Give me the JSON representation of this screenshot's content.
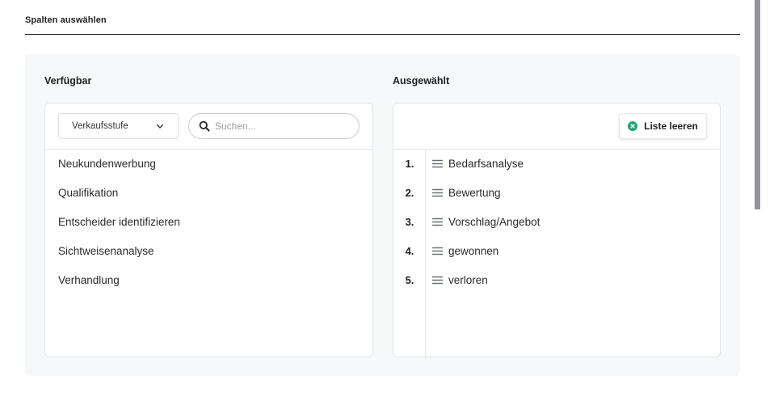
{
  "section": {
    "title": "Spalten auswählen"
  },
  "available": {
    "title": "Verfügbar",
    "filter_select": {
      "selected": "Verkaufsstufe"
    },
    "search": {
      "placeholder": "Suchen...",
      "value": ""
    },
    "items": [
      {
        "label": "Neukundenwerbung"
      },
      {
        "label": "Qualifikation"
      },
      {
        "label": "Entscheider identifizieren"
      },
      {
        "label": "Sichtweisenanalyse"
      },
      {
        "label": "Verhandlung"
      }
    ]
  },
  "selected": {
    "title": "Ausgewählt",
    "clear_button": "Liste leeren",
    "items": [
      {
        "num": "1.",
        "label": "Bedarfsanalyse"
      },
      {
        "num": "2.",
        "label": "Bewertung"
      },
      {
        "num": "3.",
        "label": "Vorschlag/Angebot"
      },
      {
        "num": "4.",
        "label": "gewonnen"
      },
      {
        "num": "5.",
        "label": "verloren"
      }
    ]
  },
  "icons": {
    "select": "chevron-down-icon",
    "search": "search-icon",
    "clear": "close-circle-icon",
    "drag": "drag-handle-icon"
  },
  "colors": {
    "accent_green": "#17a673",
    "panel_bg": "#f7f8f9",
    "border": "#e3e5e8"
  }
}
